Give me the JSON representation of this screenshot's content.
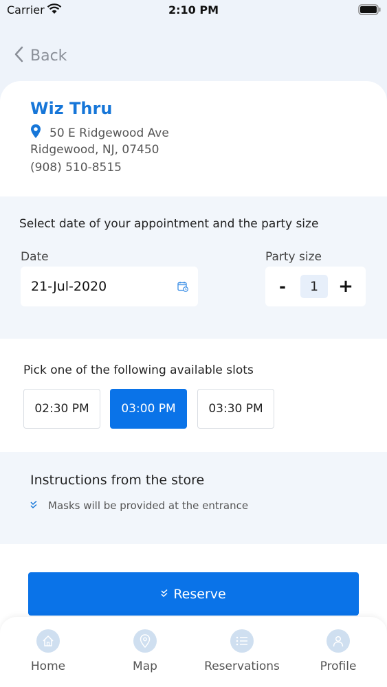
{
  "status_bar": {
    "carrier": "Carrier",
    "time": "2:10 PM"
  },
  "nav": {
    "back_label": "Back"
  },
  "store": {
    "name": "Wiz Thru",
    "address_line1": "50 E Ridgewood Ave",
    "address_line2": "Ridgewood, NJ, 07450",
    "phone": "(908) 510-8515"
  },
  "booking": {
    "title": "Select date of your appointment and the party size",
    "date_label": "Date",
    "date_value": "21-Jul-2020",
    "party_label": "Party size",
    "party_minus": "-",
    "party_count": "1",
    "party_plus": "+"
  },
  "slots": {
    "title": "Pick one of the following available slots",
    "items": [
      {
        "label": "02:30 PM",
        "selected": false
      },
      {
        "label": "03:00 PM",
        "selected": true
      },
      {
        "label": "03:30 PM",
        "selected": false
      }
    ]
  },
  "instructions": {
    "title": "Instructions from the store",
    "items": [
      "Masks will be provided at the entrance"
    ]
  },
  "reserve": {
    "label": "Reserve"
  },
  "tabbar": {
    "items": [
      {
        "label": "Home",
        "icon": "home-icon"
      },
      {
        "label": "Map",
        "icon": "map-pin-icon"
      },
      {
        "label": "Reservations",
        "icon": "list-icon"
      },
      {
        "label": "Profile",
        "icon": "user-icon"
      }
    ]
  },
  "colors": {
    "accent": "#0a73e8",
    "store_name": "#1676d8",
    "background": "#eef3fa"
  }
}
